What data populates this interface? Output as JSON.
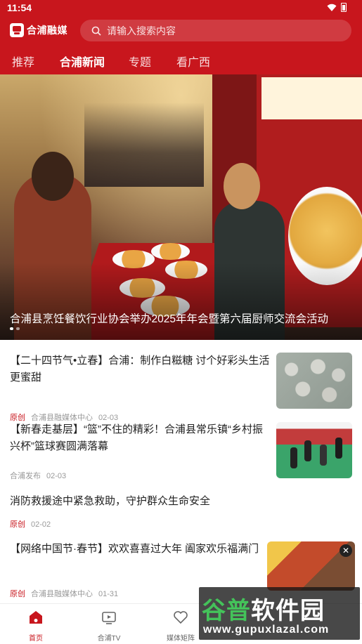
{
  "status_bar": {
    "time": "11:54"
  },
  "header": {
    "logo_text": "合浦融媒",
    "search_placeholder": "请输入搜索内容"
  },
  "tabs": [
    {
      "label": "推荐",
      "active": false
    },
    {
      "label": "合浦新闻",
      "active": true
    },
    {
      "label": "专题",
      "active": false
    },
    {
      "label": "看广西",
      "active": false
    }
  ],
  "banner": {
    "caption": "合浦县烹饪餐饮行业协会举办2025年年会暨第六届厨师交流会活动",
    "slide_count": 2,
    "active_slide": 1
  },
  "news": [
    {
      "title": "【二十四节气•立春】合浦：制作白糍糖 讨个好彩头生活更蜜甜",
      "tag": "原创",
      "source": "合浦县融媒体中心",
      "date": "02-03"
    },
    {
      "title": "【新春走基层】“篮”不住的精彩！合浦县常乐镇“乡村振兴杯”篮球赛圆满落幕",
      "tag": "",
      "source": "合浦发布",
      "date": "02-03"
    },
    {
      "title": "消防救援途中紧急救助，守护群众生命安全",
      "tag": "原创",
      "source": "",
      "date": "02-02"
    },
    {
      "title": "【网络中国节·春节】欢欢喜喜过大年 阖家欢乐福满门",
      "tag": "原创",
      "source": "合浦县融媒体中心",
      "date": "01-31"
    }
  ],
  "bottom_nav": [
    {
      "label": "首页",
      "icon": "home-icon",
      "active": true
    },
    {
      "label": "合浦TV",
      "icon": "tv-icon",
      "active": false
    },
    {
      "label": "媒体矩阵",
      "icon": "heart-hands-icon",
      "active": false
    }
  ],
  "watermark": {
    "title": "谷普软件园",
    "url": "www.gupuxlazal.com"
  },
  "colors": {
    "brand_red": "#c8161d",
    "tag_red": "#c8161d",
    "meta_gray": "#999999"
  }
}
